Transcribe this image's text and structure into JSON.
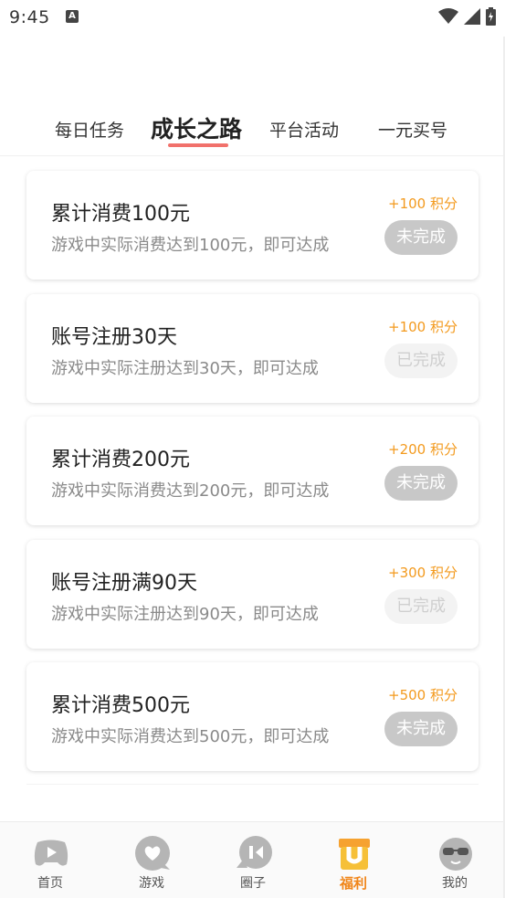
{
  "status_bar": {
    "time": "9:45",
    "notification": "A"
  },
  "tabs": [
    {
      "label": "每日任务",
      "active": false
    },
    {
      "label": "成长之路",
      "active": true
    },
    {
      "label": "平台活动",
      "active": false
    },
    {
      "label": "一元买号",
      "active": false
    }
  ],
  "tasks": [
    {
      "title": "累计消费100元",
      "desc": "游戏中实际消费达到100元，即可达成",
      "reward": "+100 积分",
      "status": "未完成",
      "done": false
    },
    {
      "title": "账号注册30天",
      "desc": "游戏中实际注册达到30天，即可达成",
      "reward": "+100 积分",
      "status": "已完成",
      "done": true
    },
    {
      "title": "累计消费200元",
      "desc": "游戏中实际消费达到200元，即可达成",
      "reward": "+200 积分",
      "status": "未完成",
      "done": false
    },
    {
      "title": "账号注册满90天",
      "desc": "游戏中实际注册达到90天，即可达成",
      "reward": "+300 积分",
      "status": "已完成",
      "done": true
    },
    {
      "title": "累计消费500元",
      "desc": "游戏中实际消费达到500元，即可达成",
      "reward": "+500 积分",
      "status": "未完成",
      "done": false
    }
  ],
  "nav": [
    {
      "label": "首页",
      "icon": "gamepad-icon",
      "active": false
    },
    {
      "label": "游戏",
      "icon": "heart-chat-icon",
      "active": false
    },
    {
      "label": "圈子",
      "icon": "circle-chat-icon",
      "active": false
    },
    {
      "label": "福利",
      "icon": "gift-icon",
      "active": true
    },
    {
      "label": "我的",
      "icon": "avatar-glasses-icon",
      "active": false
    }
  ],
  "colors": {
    "accent": "#f08519",
    "reward": "#f39a1e",
    "tab_underline": "#f1716b"
  }
}
